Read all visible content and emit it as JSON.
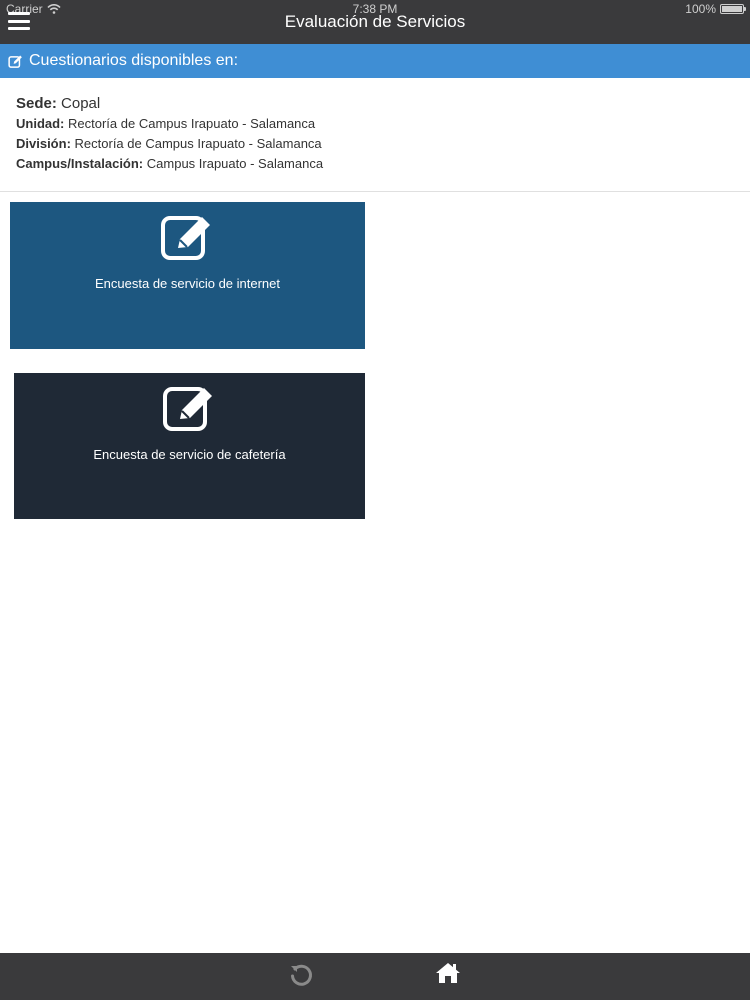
{
  "status_bar": {
    "carrier": "Carrier",
    "time": "7:38 PM",
    "battery": "100%",
    "battery_level_fraction": 1.0
  },
  "header": {
    "title": "Evaluación de Servicios",
    "menu_icon": "hamburger-menu-icon"
  },
  "section": {
    "title": "Cuestionarios disponibles en:",
    "icon": "edit-icon",
    "color": "#3f8ed4"
  },
  "info": {
    "sede_label": "Sede:",
    "sede_value": "Copal",
    "unidad_label": "Unidad:",
    "unidad_value": "Rectoría de Campus Irapuato - Salamanca",
    "division_label": "División:",
    "division_value": "Rectoría de Campus Irapuato - Salamanca",
    "campus_label": "Campus/Instalación:",
    "campus_value": "Campus Irapuato - Salamanca"
  },
  "cards": [
    {
      "label": "Encuesta de servicio de internet",
      "icon": "edit-icon",
      "color": "#1d5780"
    },
    {
      "label": "Encuesta de servicio de cafetería",
      "icon": "edit-icon",
      "color": "#1f2936"
    }
  ],
  "bottom_bar": {
    "items": [
      {
        "icon": "refresh-icon",
        "active": false
      },
      {
        "icon": "home-icon",
        "active": true
      }
    ]
  }
}
